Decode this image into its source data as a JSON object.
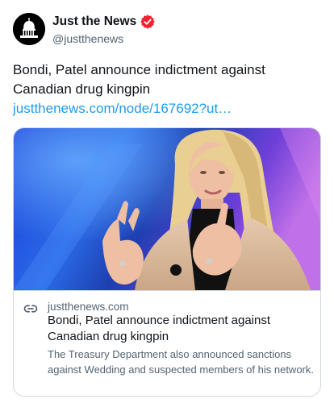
{
  "author": {
    "display_name": "Just the News",
    "handle": "@justthenews",
    "verified_icon": "verified-badge-icon",
    "verified_color": "#f4212e",
    "avatar_icon": "capitol-dome-icon"
  },
  "tweet": {
    "text": "Bondi, Patel announce indictment against Canadian drug kingpin ",
    "link_text": "justthenews.com/node/167692?ut…",
    "link_color": "#1d9bf0"
  },
  "card": {
    "image_alt": "woman with blonde hair speaking and gesturing on stage",
    "link_icon": "link-icon",
    "domain": "justthenews.com",
    "title": "Bondi, Patel announce indictment against Canadian drug kingpin",
    "description": "The Treasury Department also announced sanctions against Wedding and suspected members of his network."
  }
}
